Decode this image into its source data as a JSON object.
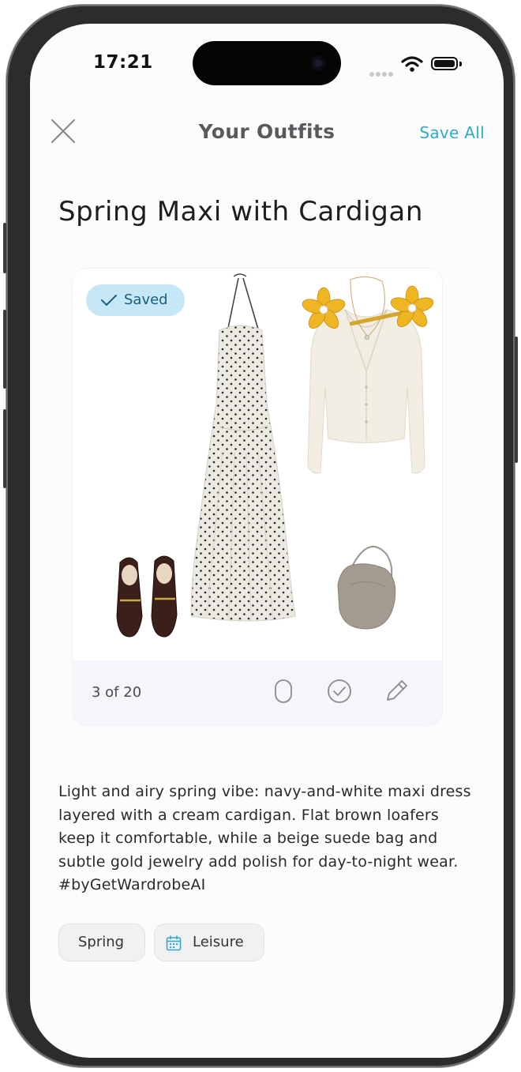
{
  "status_bar": {
    "time": "17:21"
  },
  "nav": {
    "title": "Your Outfits",
    "save_all_label": "Save All"
  },
  "outfit": {
    "title": "Spring Maxi with Cardigan",
    "saved_label": "Saved",
    "counter": "3 of 20",
    "description": "Light and airy spring vibe: navy-and-white maxi dress layered with a cream cardigan. Flat brown loafers keep it comfortable, while a beige suede bag and subtle gold jewelry add polish for day-to-night wear. #byGetWardrobeAI",
    "tags": [
      {
        "label": "Spring",
        "icon": ""
      },
      {
        "label": "Leisure",
        "icon": "calendar-icon"
      }
    ]
  },
  "colors": {
    "accent": "#2fa9cc",
    "saved_badge_bg": "#c6e7f6",
    "card_footer_bg": "#f4f6fb"
  }
}
